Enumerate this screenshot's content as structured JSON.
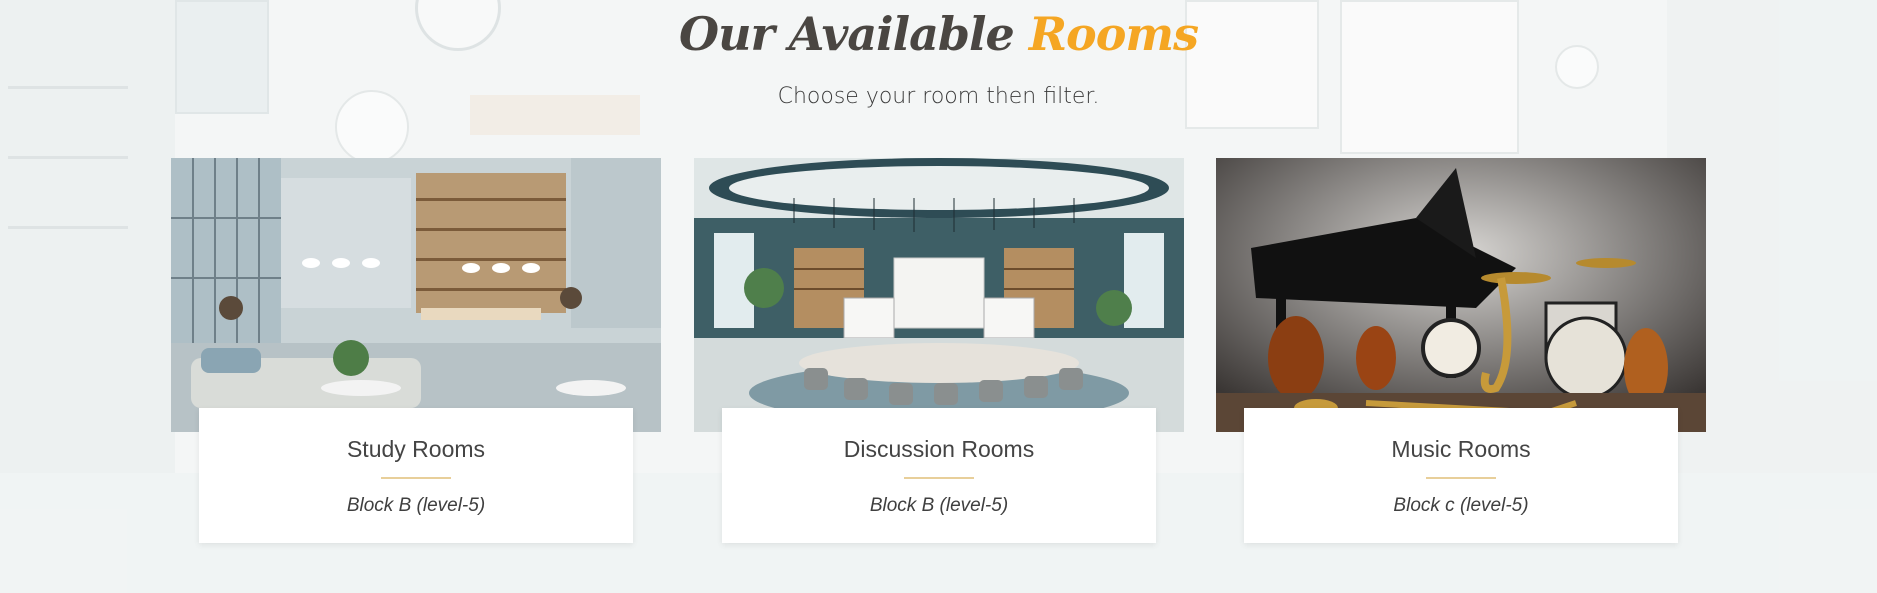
{
  "header": {
    "title_part1": "Our Available ",
    "title_part2": "Rooms",
    "subtitle": "Choose your room then filter."
  },
  "colors": {
    "accent": "#f5a623",
    "title_dark": "#4a4642",
    "divider": "#e8cf9a"
  },
  "rooms": [
    {
      "title": "Study Rooms",
      "location": "Block B (level-5)",
      "image_icon": "study-room-image"
    },
    {
      "title": "Discussion Rooms",
      "location": "Block B (level-5)",
      "image_icon": "discussion-room-image"
    },
    {
      "title": "Music Rooms",
      "location": "Block c (level-5)",
      "image_icon": "music-room-image"
    }
  ]
}
